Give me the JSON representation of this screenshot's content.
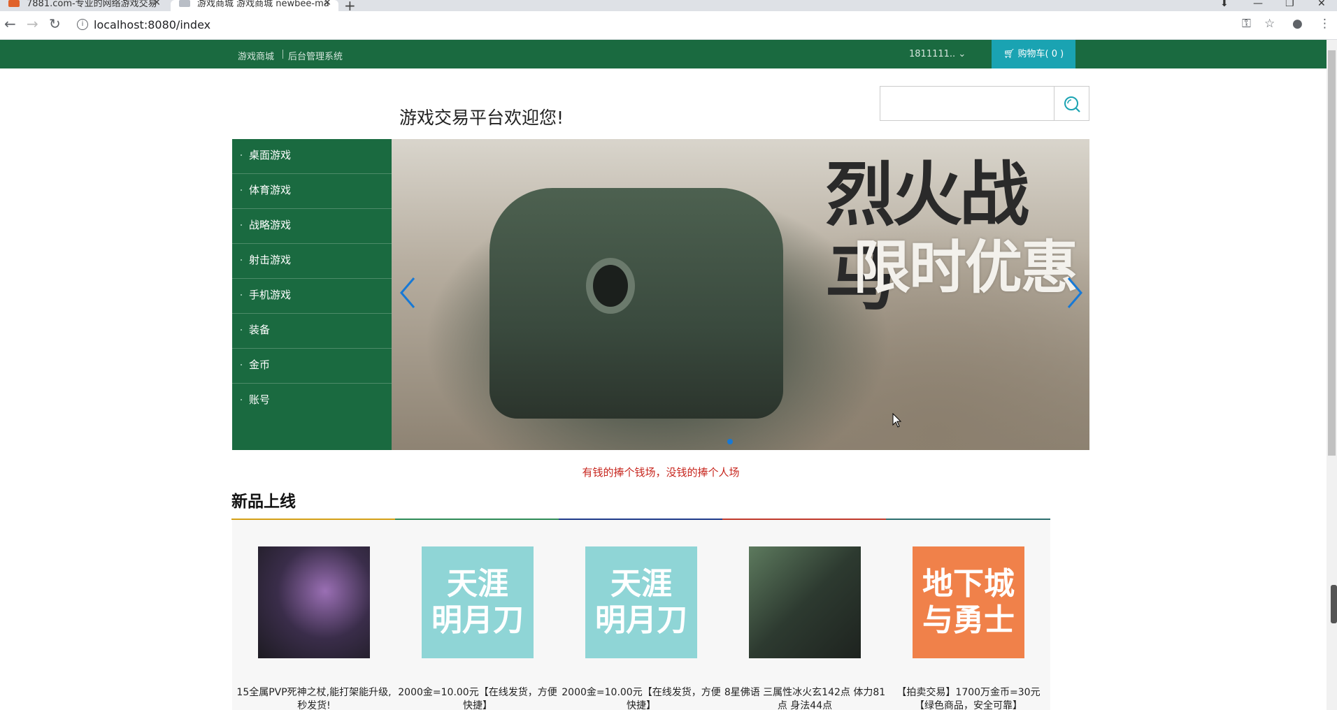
{
  "browser": {
    "tabs": [
      {
        "title": "7881.com-专业的网络游戏交易",
        "active": false
      },
      {
        "title": "游戏商城 游戏商城 newbee-ma",
        "active": true
      }
    ],
    "url": "localhost:8080/index"
  },
  "topbar": {
    "links": [
      "游戏商城",
      "后台管理系统"
    ],
    "user": "1811111..",
    "cart_label": "购物车( 0 )"
  },
  "header": {
    "welcome": "游戏交易平台欢迎您!",
    "search_placeholder": ""
  },
  "categories": [
    "桌面游戏",
    "体育游戏",
    "战略游戏",
    "射击游戏",
    "手机游戏",
    "装备",
    "金币",
    "账号"
  ],
  "banner": {
    "headline1": "烈火战马",
    "headline2": "限时优惠",
    "slide_count": 1,
    "active_slide": 0
  },
  "slogan": "有钱的捧个钱场，没钱的捧个人场",
  "new_products": {
    "title": "新品上线",
    "items": [
      {
        "image_text": "",
        "title": "15全属PVP死神之杖,能打架能升级,秒发货!",
        "bg": "#2b2a30"
      },
      {
        "image_text": "天涯\n明月刀",
        "title": "2000金=10.00元【在线发货，方便快捷】",
        "bg": "#8fd5d6"
      },
      {
        "image_text": "天涯\n明月刀",
        "title": "2000金=10.00元【在线发货，方便快捷】",
        "bg": "#8fd5d6"
      },
      {
        "image_text": "",
        "title": "8星佛语 三属性冰火玄142点 体力81点 身法44点",
        "bg": "#3b4a3c"
      },
      {
        "image_text": "地下城\n与勇士",
        "title": "【拍卖交易】1700万金币=30元 【绿色商品，安全可靠】",
        "bg": "#f0814a"
      }
    ]
  },
  "colors": {
    "primary_green": "#1a6a40",
    "cart_teal": "#1aa3b2",
    "slogan_red": "#c7261e",
    "rule_colors": [
      "#d4a017",
      "#2e8b57",
      "#1e3a8a",
      "#c0392b",
      "#2c6e6e"
    ]
  }
}
